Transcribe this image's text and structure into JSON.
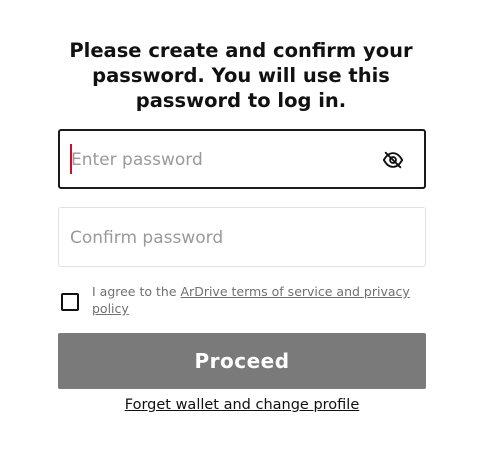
{
  "dialog": {
    "heading": "Please create and confirm your password. You will use this password to log in."
  },
  "password": {
    "placeholder": "Enter password",
    "visibility_icon": "eye-slash-icon",
    "focused": true,
    "caret_color": "#c8102e"
  },
  "confirm": {
    "placeholder": "Confirm password"
  },
  "agreement": {
    "checked": false,
    "prefix": "I agree to the",
    "link_text": "ArDrive terms of service and privacy policy"
  },
  "actions": {
    "proceed_label": "Proceed",
    "proceed_color": "#7a7a7a",
    "forget_label": "Forget wallet and change profile"
  }
}
